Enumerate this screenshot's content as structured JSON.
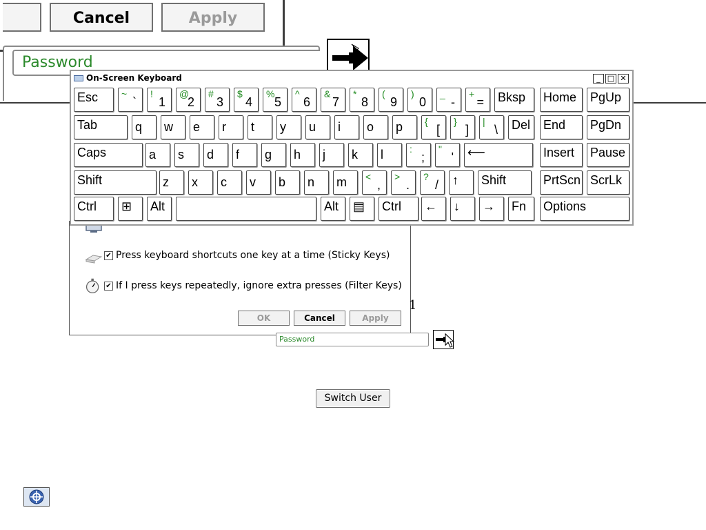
{
  "magnified_dialog": {
    "cancel_label": "Cancel",
    "apply_label": "Apply",
    "password_placeholder": "Password"
  },
  "osk": {
    "title": "On-Screen Keyboard",
    "rows": [
      [
        {
          "label": "Esc"
        },
        {
          "shift": "~",
          "base": "`"
        },
        {
          "shift": "!",
          "base": "1"
        },
        {
          "shift": "@",
          "base": "2"
        },
        {
          "shift": "#",
          "base": "3"
        },
        {
          "shift": "$",
          "base": "4"
        },
        {
          "shift": "%",
          "base": "5"
        },
        {
          "shift": "^",
          "base": "6"
        },
        {
          "shift": "&",
          "base": "7"
        },
        {
          "shift": "*",
          "base": "8"
        },
        {
          "shift": "(",
          "base": "9"
        },
        {
          "shift": ")",
          "base": "0"
        },
        {
          "shift": "_",
          "base": "-"
        },
        {
          "shift": "+",
          "base": "="
        },
        {
          "label": "Bksp"
        },
        {
          "label": "Home"
        },
        {
          "label": "PgUp"
        }
      ],
      [
        {
          "label": "Tab"
        },
        {
          "label": "q"
        },
        {
          "label": "w"
        },
        {
          "label": "e"
        },
        {
          "label": "r"
        },
        {
          "label": "t"
        },
        {
          "label": "y"
        },
        {
          "label": "u"
        },
        {
          "label": "i"
        },
        {
          "label": "o"
        },
        {
          "label": "p"
        },
        {
          "shift": "{",
          "base": "["
        },
        {
          "shift": "}",
          "base": "]"
        },
        {
          "shift": "|",
          "base": "\\"
        },
        {
          "label": "Del"
        },
        {
          "label": "End"
        },
        {
          "label": "PgDn"
        }
      ],
      [
        {
          "label": "Caps"
        },
        {
          "label": "a"
        },
        {
          "label": "s"
        },
        {
          "label": "d"
        },
        {
          "label": "f"
        },
        {
          "label": "g"
        },
        {
          "label": "h"
        },
        {
          "label": "j"
        },
        {
          "label": "k"
        },
        {
          "label": "l"
        },
        {
          "shift": ":",
          "base": ";"
        },
        {
          "shift": "\"",
          "base": "'"
        },
        {
          "label": "⟵"
        },
        {
          "label": "Insert"
        },
        {
          "label": "Pause"
        }
      ],
      [
        {
          "label": "Shift"
        },
        {
          "label": "z"
        },
        {
          "label": "x"
        },
        {
          "label": "c"
        },
        {
          "label": "v"
        },
        {
          "label": "b"
        },
        {
          "label": "n"
        },
        {
          "label": "m"
        },
        {
          "shift": "<",
          "base": ","
        },
        {
          "shift": ">",
          "base": "."
        },
        {
          "shift": "?",
          "base": "/"
        },
        {
          "label": "↑"
        },
        {
          "label": "Shift"
        },
        {
          "label": "PrtScn"
        },
        {
          "label": "ScrLk"
        }
      ],
      [
        {
          "label": "Ctrl"
        },
        {
          "label": "⊞"
        },
        {
          "label": "Alt"
        },
        {
          "label": ""
        },
        {
          "label": "Alt"
        },
        {
          "label": "▤"
        },
        {
          "label": "Ctrl"
        },
        {
          "label": "←"
        },
        {
          "label": "↓"
        },
        {
          "label": "→"
        },
        {
          "label": "Fn"
        },
        {
          "label": "Options"
        }
      ]
    ]
  },
  "ease_dialog": {
    "sticky_keys": "Press keyboard shortcuts one key at a time (Sticky Keys)",
    "filter_keys": "If I press keys repeatedly, ignore extra presses (Filter Keys)",
    "ok_label": "OK",
    "cancel_label": "Cancel",
    "apply_label": "Apply"
  },
  "login": {
    "password_placeholder": "Password",
    "stray_text": "1",
    "switch_user_label": "Switch User"
  }
}
